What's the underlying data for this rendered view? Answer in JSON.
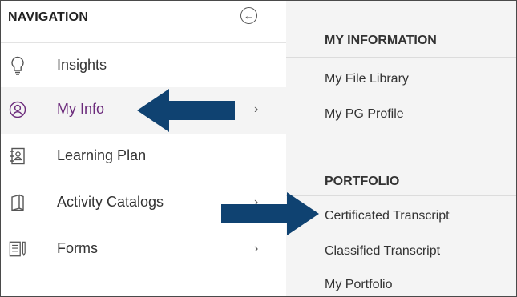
{
  "nav": {
    "title": "NAVIGATION",
    "collapse_glyph": "←",
    "items": [
      {
        "label": "Insights",
        "icon": "lightbulb-icon"
      },
      {
        "label": "My Info",
        "icon": "user-circle-icon",
        "chevron": "›"
      },
      {
        "label": "Learning Plan",
        "icon": "address-book-icon"
      },
      {
        "label": "Activity Catalogs",
        "icon": "book-icon",
        "chevron": "›"
      },
      {
        "label": "Forms",
        "icon": "forms-icon",
        "chevron": "›"
      }
    ]
  },
  "panel": {
    "sections": [
      {
        "title": "MY INFORMATION",
        "links": [
          "My File Library",
          "My PG Profile"
        ]
      },
      {
        "title": "PORTFOLIO",
        "links": [
          "Certificated Transcript",
          "Classified Transcript",
          "My Portfolio"
        ]
      }
    ]
  },
  "colors": {
    "active_label": "#6b2a7b",
    "arrow": "#0f4271"
  }
}
